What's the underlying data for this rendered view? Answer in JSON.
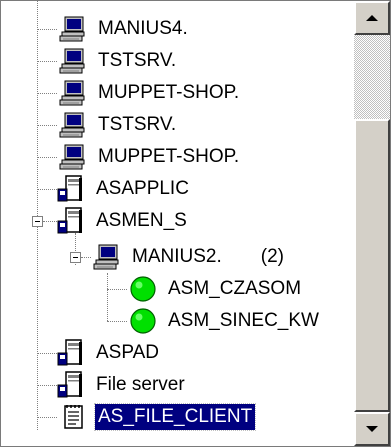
{
  "tree": {
    "nodes": [
      {
        "label": "MANIUS4.",
        "icon": "network-computer-icon"
      },
      {
        "label": "TSTSRV.",
        "icon": "network-computer-icon"
      },
      {
        "label": "MUPPET-SHOP.",
        "icon": "network-computer-icon"
      },
      {
        "label": "TSTSRV.",
        "icon": "network-computer-icon"
      },
      {
        "label": "MUPPET-SHOP.",
        "icon": "network-computer-icon"
      },
      {
        "label": "ASAPPLIC",
        "icon": "application-server-icon"
      },
      {
        "label": "ASMEN_S",
        "icon": "application-server-icon",
        "expanded": true
      },
      {
        "label": "MANIUS2.",
        "count": "(2)",
        "icon": "network-computer-icon",
        "expanded": true
      },
      {
        "label": "ASM_CZASOM",
        "icon": "green-status-icon"
      },
      {
        "label": "ASM_SINEC_KW",
        "icon": "green-status-icon"
      },
      {
        "label": "ASPAD",
        "icon": "application-server-icon"
      },
      {
        "label": "File server",
        "icon": "application-server-icon"
      },
      {
        "label": "AS_FILE_CLIENT",
        "icon": "notepad-document-icon",
        "selected": true
      }
    ]
  },
  "colors": {
    "selection_bg": "#000080",
    "selection_fg": "#ffffff",
    "status_ok": "#00e000",
    "window_face": "#d4d0c8"
  }
}
